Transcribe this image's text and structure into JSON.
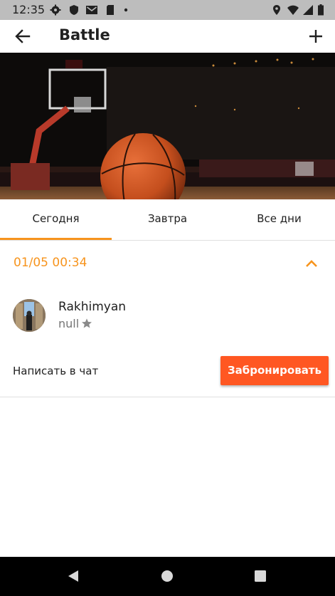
{
  "status_bar": {
    "time": "12:35",
    "left_icons": [
      "gear-icon",
      "shield-icon",
      "mail-icon",
      "sd-card-icon",
      "dot-icon"
    ],
    "right_icons": [
      "location-icon",
      "wifi-icon",
      "signal-icon",
      "battery-icon"
    ]
  },
  "app_bar": {
    "title": "Battle",
    "back_icon": "arrow-back-icon",
    "action_icon": "add-icon"
  },
  "banner": {
    "image": "basketball-court-photo"
  },
  "tabs": [
    {
      "label": "Сегодня",
      "selected": true
    },
    {
      "label": "Завтра",
      "selected": false
    },
    {
      "label": "Все дни",
      "selected": false
    }
  ],
  "schedule": {
    "datetime": "01/05 00:34",
    "expanded": true,
    "user": {
      "name": "Rakhimyan",
      "rating": "null"
    },
    "chat_label": "Написать в чат",
    "book_label": "Забронировать"
  },
  "colors": {
    "accent": "#f7941d",
    "button": "#ff5722",
    "status_bar": "#bdbdbd",
    "nav_bar": "#000000"
  },
  "nav_bar": {
    "buttons": [
      "back-triangle-icon",
      "home-circle-icon",
      "recents-square-icon"
    ]
  }
}
